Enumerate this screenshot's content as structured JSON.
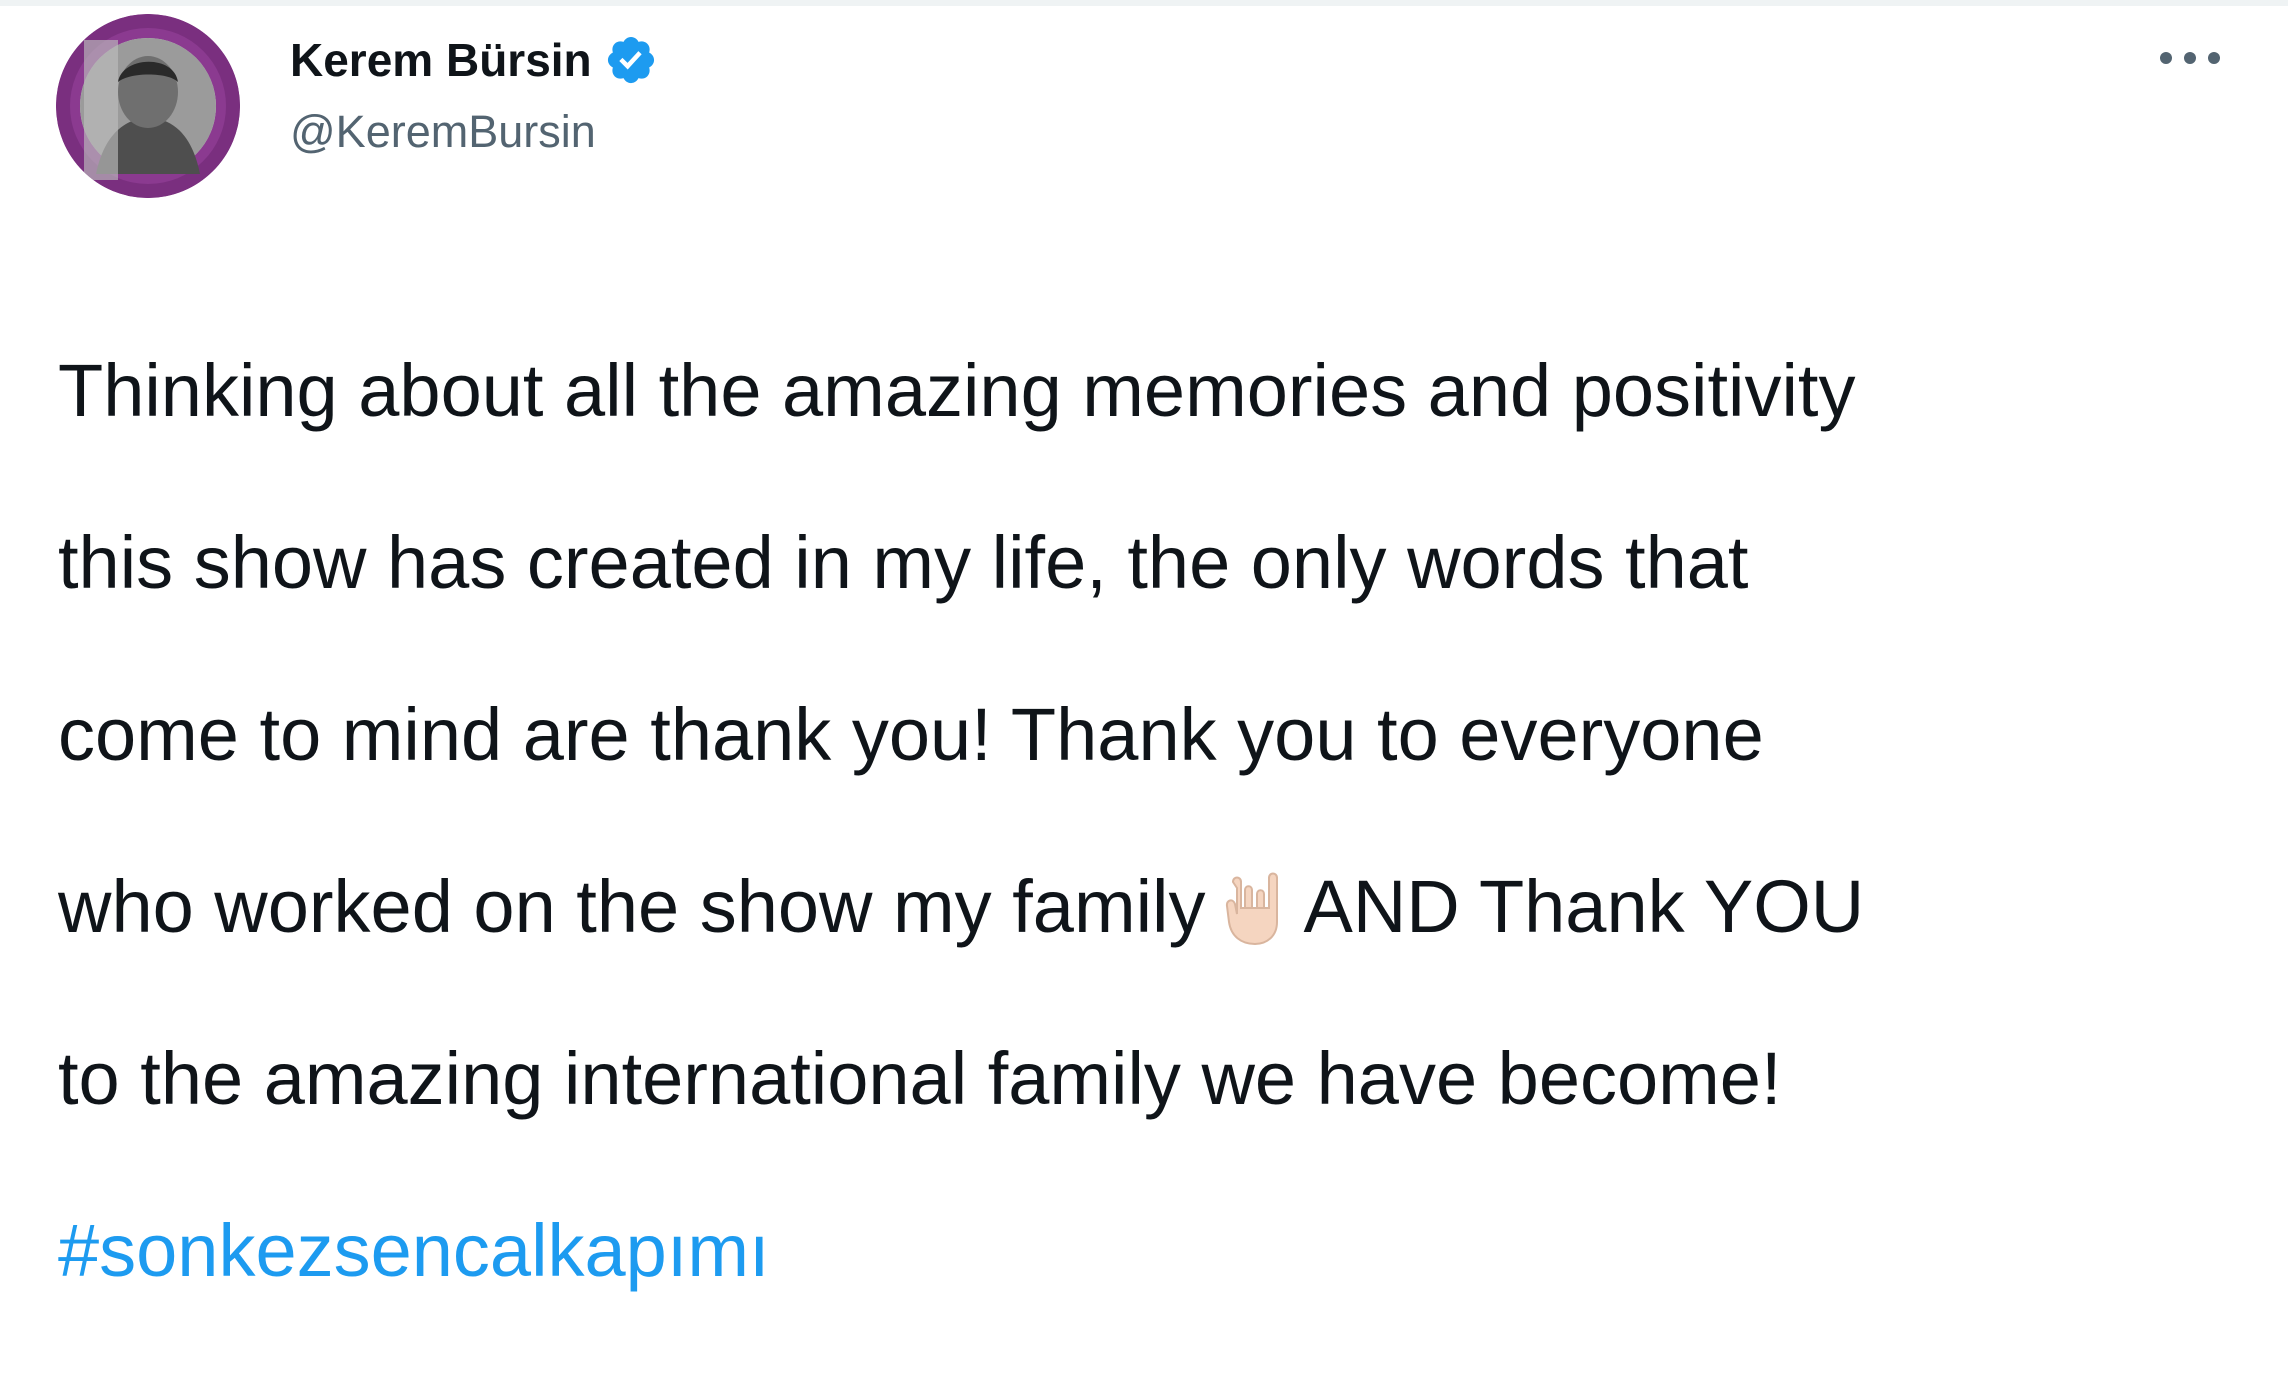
{
  "tweet": {
    "author": {
      "display_name": "Kerem Bürsin",
      "handle": "@KeremBursin",
      "verified": true,
      "verified_icon": "verified-badge-icon",
      "avatar_icon": "profile-avatar"
    },
    "more_options_icon": "more-horizontal-icon",
    "body_lines": [
      "Thinking about all the amazing memories and positivity",
      "this show has created in my life, the only words that",
      "come to mind are thank you! Thank you to everyone",
      "who worked on the show my family",
      "AND Thank YOU",
      "to the amazing international family we have become!"
    ],
    "emoji": "rock-on-hand-emoji",
    "hashtag": "#sonkezsencalkapımı",
    "colors": {
      "text": "#0f1419",
      "secondary": "#536471",
      "link": "#1d9bf0",
      "verified": "#1d9bf0",
      "avatar_ring": "#7a2f7f"
    }
  }
}
